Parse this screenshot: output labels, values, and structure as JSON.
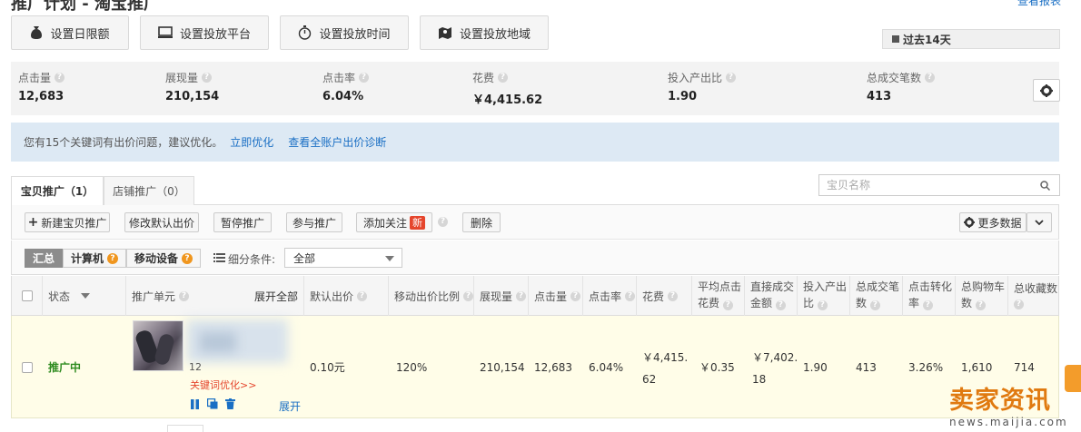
{
  "header": {
    "title": "推广计划 - 淘宝推广",
    "top_link": "查看报表"
  },
  "settings_buttons": [
    {
      "label": "设置日限额",
      "icon": "money-bag-icon"
    },
    {
      "label": "设置投放平台",
      "icon": "monitor-icon"
    },
    {
      "label": "设置投放时间",
      "icon": "stopwatch-icon"
    },
    {
      "label": "设置投放地域",
      "icon": "map-icon"
    }
  ],
  "date_range": {
    "label": "过去14天",
    "icon": "calendar-icon"
  },
  "metrics": [
    {
      "label": "点击量",
      "value": "12,683"
    },
    {
      "label": "展现量",
      "value": "210,154"
    },
    {
      "label": "点击率",
      "value": "6.04%"
    },
    {
      "label": "花费",
      "value": "￥4,415.62"
    },
    {
      "label": "投入产出比",
      "value": "1.90"
    },
    {
      "label": "总成交笔数",
      "value": "413"
    }
  ],
  "notice": {
    "text": "您有15个关键词有出价问题，建议优化。",
    "link1": "立即优化",
    "link2": "查看全账户出价诊断"
  },
  "tabs": [
    {
      "label": "宝贝推广（1）",
      "active": true
    },
    {
      "label": "店铺推广（0）",
      "active": false
    }
  ],
  "search": {
    "placeholder": "宝贝名称",
    "value": ""
  },
  "actions": {
    "new": "新建宝贝推广",
    "edit_bid": "修改默认出价",
    "pause": "暂停推广",
    "join": "参与推广",
    "follow": "添加关注",
    "new_badge": "新",
    "delete": "删除",
    "more_data": "更多数据"
  },
  "filter": {
    "segments": [
      "汇总",
      "计算机",
      "移动设备"
    ],
    "condition_label": "细分条件:",
    "condition_value": "全部"
  },
  "table": {
    "headers": {
      "status": "状态",
      "unit": "推广单元",
      "expand_all": "展开全部",
      "default_bid": "默认出价",
      "mobile_ratio": "移动出价比例",
      "impressions": "展现量",
      "clicks": "点击量",
      "ctr": "点击率",
      "cost": "花费",
      "avg_cpc_1": "平均点击",
      "avg_cpc_2": "花费",
      "direct_gmv_1": "直接成交",
      "direct_gmv_2": "金额",
      "roi_1": "投入产出",
      "roi_2": "比",
      "orders_1": "总成交笔",
      "orders_2": "数",
      "cvr_1": "点击转化",
      "cvr_2": "率",
      "cart_1": "总购物车",
      "cart_2": "数",
      "fav": "总收藏数"
    },
    "row": {
      "status": "推广中",
      "unit_id_fragment": "12",
      "keyword_link": "关键词优化>>",
      "expand": "展开",
      "default_bid": "0.10元",
      "mobile_ratio": "120%",
      "impressions": "210,154",
      "clicks": "12,683",
      "ctr": "6.04%",
      "cost_1": "￥4,415.",
      "cost_2": "62",
      "avg_cpc": "￥0.35",
      "direct_gmv_1": "￥7,402.",
      "direct_gmv_2": "18",
      "roi": "1.90",
      "orders": "413",
      "cvr": "3.26%",
      "cart": "1,610",
      "fav": "714"
    }
  },
  "watermark": {
    "cn": "卖家资讯",
    "en": "news.maijia.com"
  },
  "colors": {
    "accent_blue": "#1a6fc4",
    "status_green": "#2e8b1f",
    "badge_red": "#e5452c",
    "watermark_orange": "#e07a10"
  }
}
